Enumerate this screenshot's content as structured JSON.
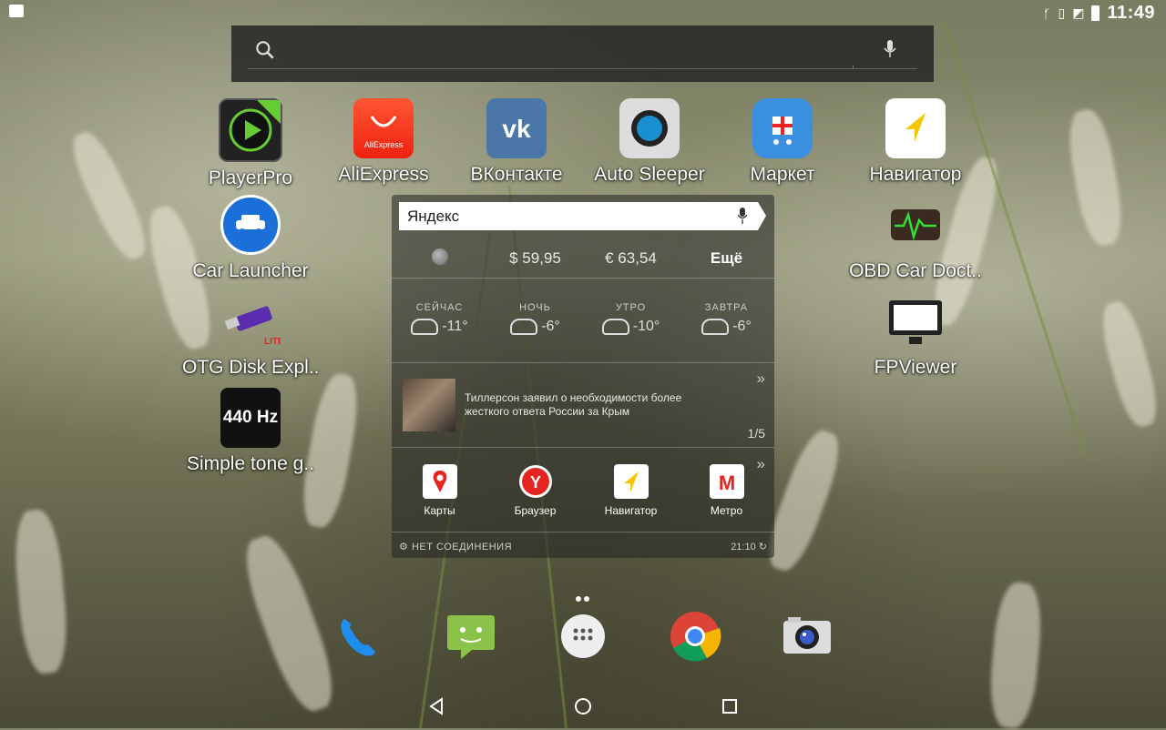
{
  "status_bar": {
    "time": "11:49",
    "icons": [
      "bluetooth-icon",
      "vibrate-icon",
      "no-sim-icon",
      "battery-icon"
    ]
  },
  "search_bar": {
    "icons": [
      "search-icon",
      "mic-icon"
    ]
  },
  "apps": [
    {
      "id": "playerpro",
      "label": "PlayerPro",
      "icon": "playerpro-icon"
    },
    {
      "id": "aliexpress",
      "label": "AliExpress",
      "icon": "aliexpress-icon"
    },
    {
      "id": "vkontakte",
      "label": "ВКонтакте",
      "icon": "vk-icon"
    },
    {
      "id": "autosleeper",
      "label": "Auto Sleeper",
      "icon": "auto-sleeper-icon"
    },
    {
      "id": "market",
      "label": "Маркет",
      "icon": "market-icon"
    },
    {
      "id": "navigator",
      "label": "Навигатор",
      "icon": "navigator-icon"
    },
    {
      "id": "carlauncher",
      "label": "Car Launcher",
      "icon": "car-launcher-icon"
    },
    {
      "id": "obd",
      "label": "OBD Car Doct..",
      "icon": "obd-icon"
    },
    {
      "id": "otg",
      "label": "OTG Disk Expl..",
      "icon": "usb-icon"
    },
    {
      "id": "fpviewer",
      "label": "FPViewer",
      "icon": "monitor-icon"
    },
    {
      "id": "tone",
      "label": "Simple tone g..",
      "icon": "tone-440hz-icon",
      "icon_text": "440 Hz"
    }
  ],
  "yandex_widget": {
    "search_brand": "Яндекс",
    "rates": {
      "usd": "$ 59,95",
      "eur": "€ 63,54",
      "more": "Ещё"
    },
    "weather": [
      {
        "label": "СЕЙЧАС",
        "temp": "-11°"
      },
      {
        "label": "НОЧЬ",
        "temp": "-6°"
      },
      {
        "label": "УТРО",
        "temp": "-10°"
      },
      {
        "label": "ЗАВТРА",
        "temp": "-6°"
      }
    ],
    "news": {
      "text": "Тиллерсон заявил о необходимости более жесткого ответа России за Крым",
      "pager": "1/5",
      "chevron": "»"
    },
    "apps": [
      {
        "label": "Карты",
        "icon": "yandex-maps-icon",
        "color": "#e52620"
      },
      {
        "label": "Браузер",
        "icon": "yandex-browser-icon",
        "color": "#e52620"
      },
      {
        "label": "Навигатор",
        "icon": "yandex-navigator-icon",
        "color": "#f6c600"
      },
      {
        "label": "Метро",
        "icon": "yandex-metro-icon",
        "color": "#e52620"
      }
    ],
    "footer": {
      "status": "НЕТ СОЕДИНЕНИЯ",
      "time": "21:10"
    }
  },
  "dock": [
    {
      "id": "phone",
      "icon": "phone-icon"
    },
    {
      "id": "messages",
      "icon": "messages-icon"
    },
    {
      "id": "app-drawer",
      "icon": "app-drawer-icon"
    },
    {
      "id": "chrome",
      "icon": "chrome-icon"
    },
    {
      "id": "camera",
      "icon": "camera-icon"
    }
  ],
  "nav_bar": {
    "icons": [
      "back-icon",
      "home-icon",
      "recents-icon"
    ]
  }
}
